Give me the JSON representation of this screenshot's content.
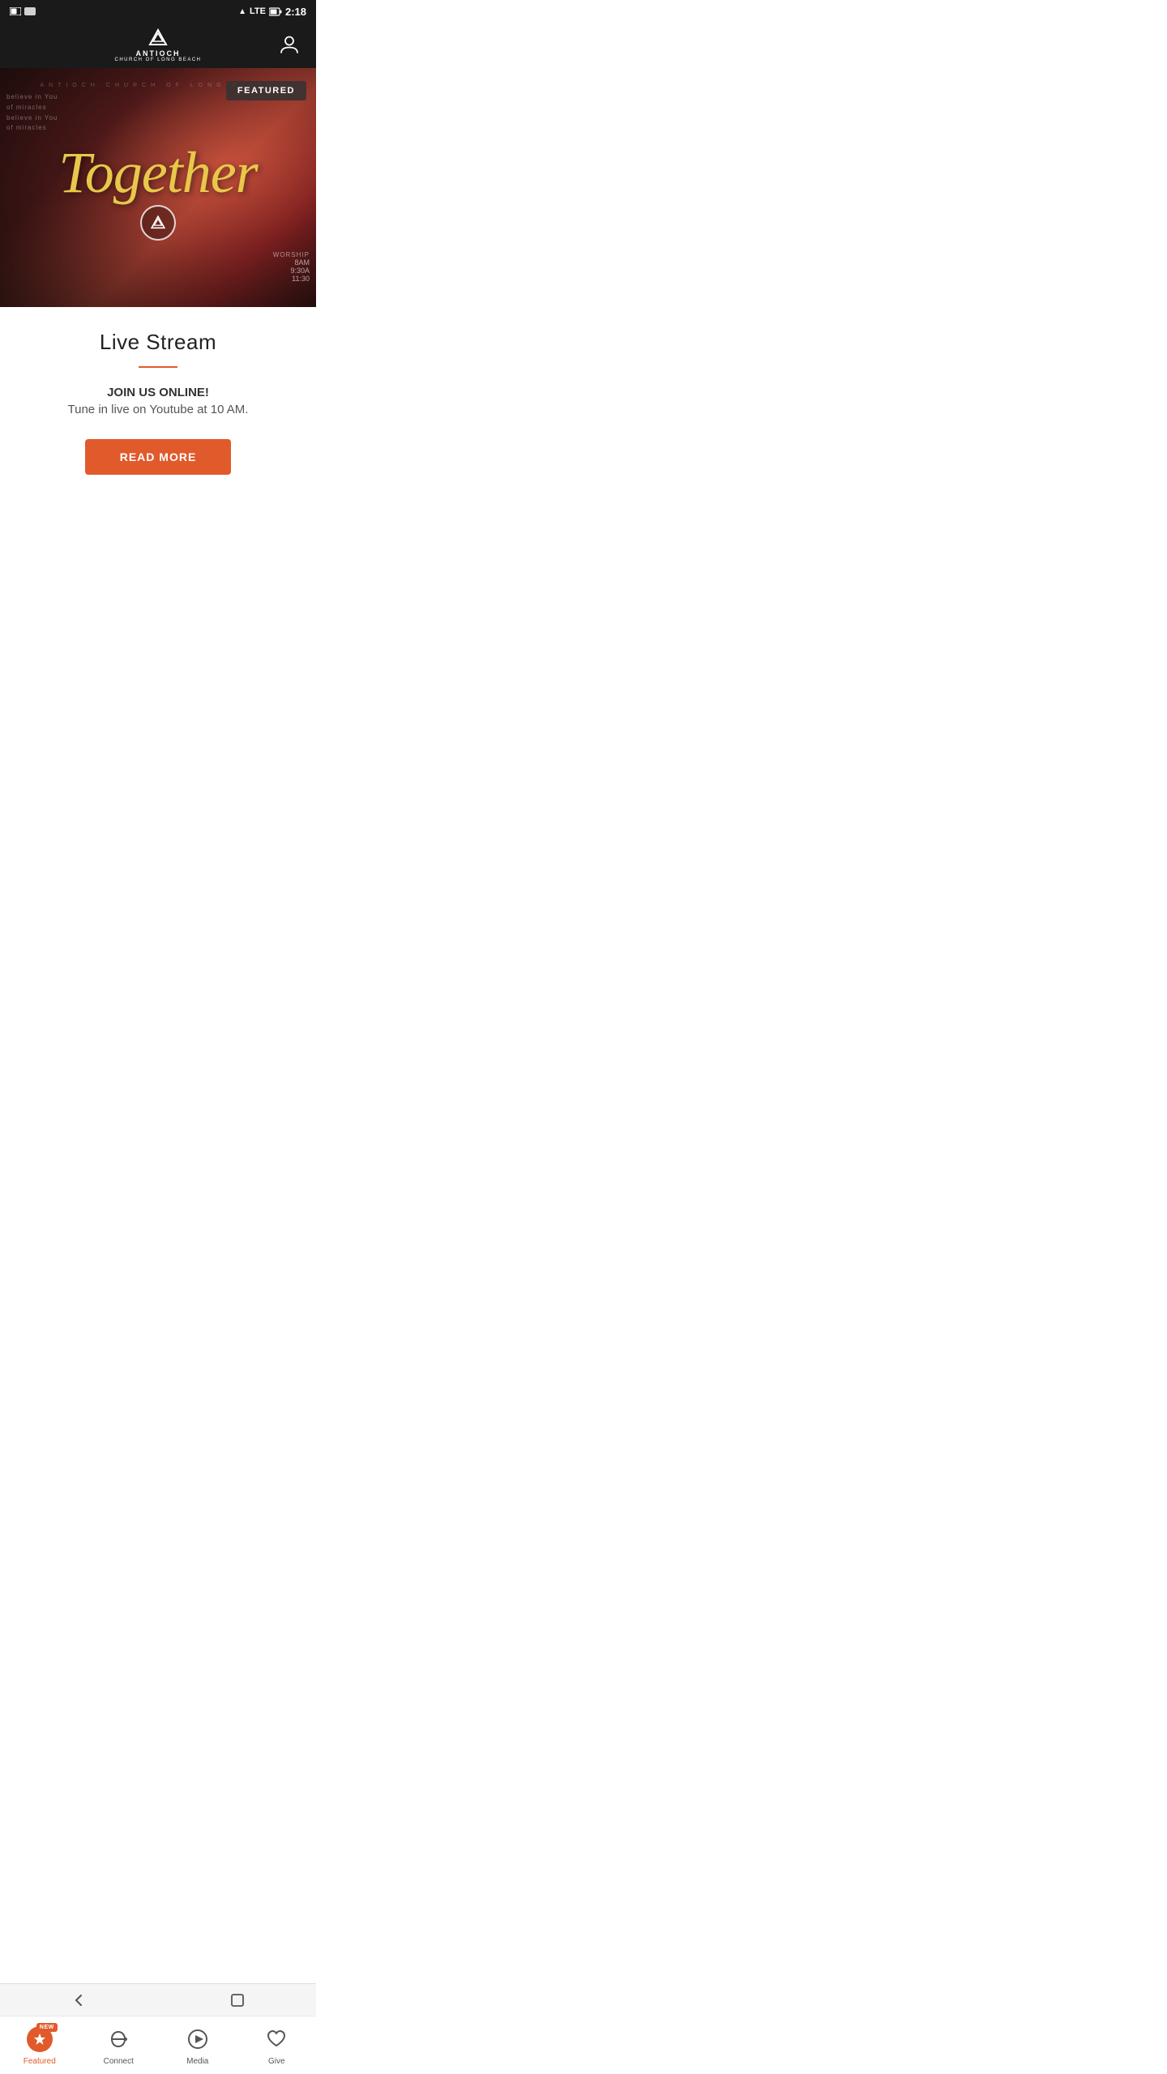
{
  "app": {
    "name": "Antioch Church of Long Beach",
    "logo_text": "ANTIOCH",
    "logo_subtext": "CHURCH OF LONG BEACH"
  },
  "status_bar": {
    "time": "2:18",
    "signal": "LTE",
    "battery": "75"
  },
  "hero": {
    "church_banner": "ANTIOCH CHURCH OF LONG BEACH",
    "title": "Together",
    "featured_label": "FEATURED",
    "worship_label": "WORSHIP",
    "worship_times": [
      "8AM",
      "9:30A",
      "11:30"
    ]
  },
  "content": {
    "page_title": "Live Stream",
    "join_headline": "JOIN US ONLINE!",
    "tune_text": "Tune in live on Youtube at 10 AM.",
    "read_more_label": "READ MORE"
  },
  "bottom_nav": {
    "items": [
      {
        "id": "featured",
        "label": "Featured",
        "icon": "star",
        "new_badge": "NEW",
        "active": true
      },
      {
        "id": "connect",
        "label": "Connect",
        "icon": "connect"
      },
      {
        "id": "media",
        "label": "Media",
        "icon": "play"
      },
      {
        "id": "give",
        "label": "Give",
        "icon": "heart"
      }
    ]
  },
  "system_nav": {
    "back_label": "←",
    "home_label": "□"
  }
}
